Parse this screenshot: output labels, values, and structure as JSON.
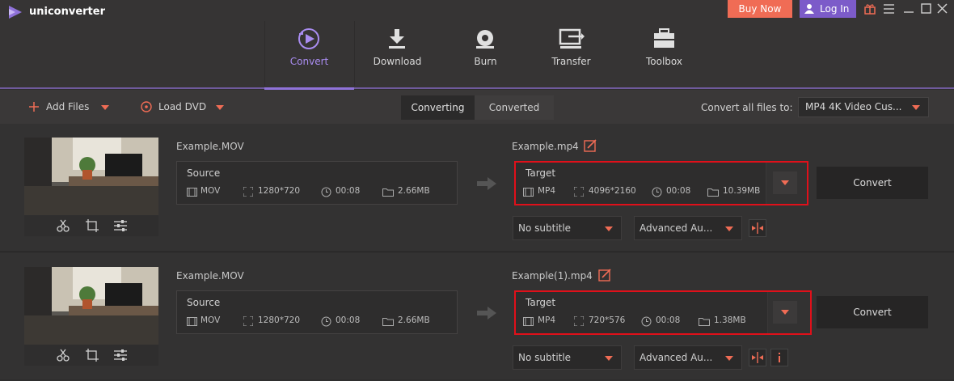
{
  "app": {
    "name": "uniconverter"
  },
  "header": {
    "buy_now": "Buy Now",
    "login": "Log In"
  },
  "nav": {
    "items": [
      {
        "label": "Convert",
        "icon": "convert-icon",
        "active": true
      },
      {
        "label": "Download",
        "icon": "download-icon"
      },
      {
        "label": "Burn",
        "icon": "burn-icon"
      },
      {
        "label": "Transfer",
        "icon": "transfer-icon"
      },
      {
        "label": "Toolbox",
        "icon": "toolbox-icon"
      }
    ]
  },
  "toolbar": {
    "add_files": "Add Files",
    "load_dvd": "Load DVD",
    "tabs": [
      "Converting",
      "Converted"
    ],
    "convert_all_label": "Convert all files to:",
    "convert_all_value": "MP4 4K Video Cus..."
  },
  "files": [
    {
      "source_name": "Example.MOV",
      "target_name": "Example.mp4",
      "source": {
        "title": "Source",
        "format": "MOV",
        "resolution": "1280*720",
        "duration": "00:08",
        "size": "2.66MB"
      },
      "target": {
        "title": "Target",
        "format": "MP4",
        "resolution": "4096*2160",
        "duration": "00:08",
        "size": "10.39MB"
      },
      "subtitle": "No subtitle",
      "audio": "Advanced Au...",
      "convert_label": "Convert"
    },
    {
      "source_name": "Example.MOV",
      "target_name": "Example(1).mp4",
      "source": {
        "title": "Source",
        "format": "MOV",
        "resolution": "1280*720",
        "duration": "00:08",
        "size": "2.66MB"
      },
      "target": {
        "title": "Target",
        "format": "MP4",
        "resolution": "720*576",
        "duration": "00:08",
        "size": "1.38MB"
      },
      "subtitle": "No subtitle",
      "audio": "Advanced Au...",
      "convert_label": "Convert"
    }
  ],
  "colors": {
    "accent": "#8f72d9",
    "buy": "#f06c55",
    "login": "#7c5bc9",
    "highlight": "#e0101a"
  }
}
